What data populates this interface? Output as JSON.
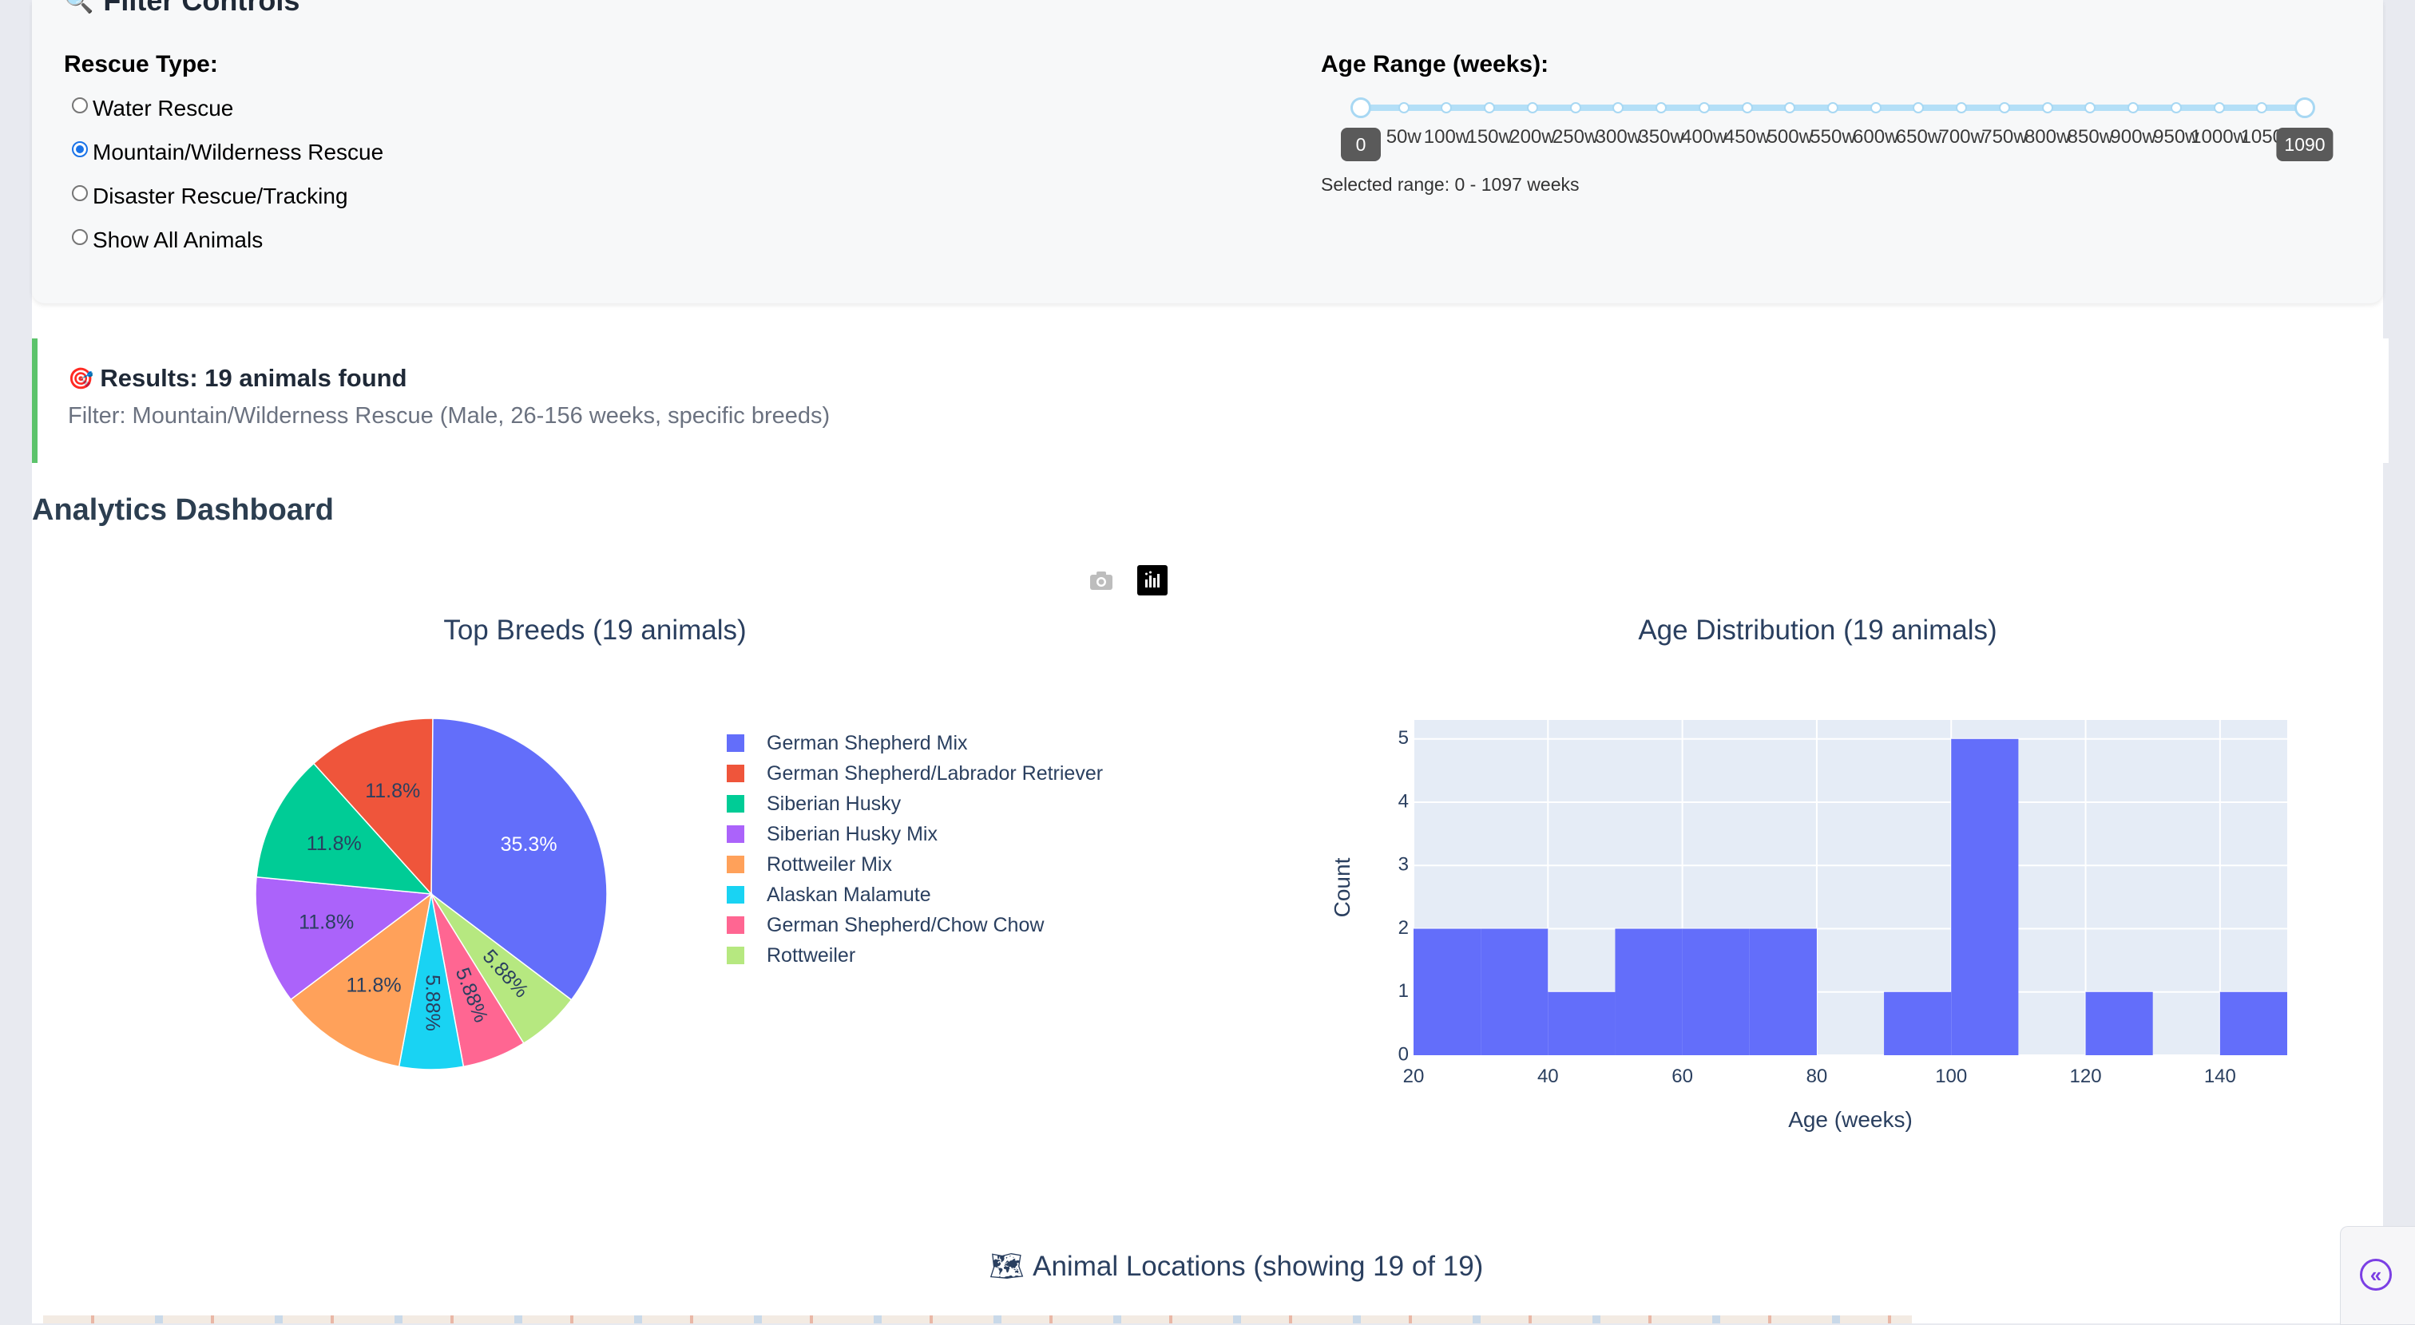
{
  "filter": {
    "title": "Filter Controls",
    "icon": "magnifier-icon",
    "rescue_type_label": "Rescue Type:",
    "rescue_options": [
      {
        "label": "Water Rescue",
        "checked": false
      },
      {
        "label": "Mountain/Wilderness Rescue",
        "checked": true
      },
      {
        "label": "Disaster Rescue/Tracking",
        "checked": false
      },
      {
        "label": "Show All Animals",
        "checked": false
      }
    ],
    "age_label": "Age Range (weeks):",
    "slider": {
      "min": 0,
      "max": 1097,
      "value_low": 0,
      "value_high": 1097,
      "low_tooltip": "0",
      "high_tooltip": "1090",
      "marks": [
        "50w",
        "100w",
        "150w",
        "200w",
        "250w",
        "300w",
        "350w",
        "400w",
        "450w",
        "500w",
        "550w",
        "600w",
        "650w",
        "700w",
        "750w",
        "800w",
        "850w",
        "900w",
        "950w",
        "1000w",
        "1050"
      ],
      "range_text": "Selected range: 0 - 1097 weeks"
    }
  },
  "results": {
    "icon": "target-icon",
    "title": "Results: 19 animals found",
    "subtitle": "Filter: Mountain/Wilderness Rescue (Male, 26-156 weeks, specific breeds)"
  },
  "dashboard": {
    "title": "Analytics Dashboard",
    "modebar": [
      "camera-icon",
      "plotly-logo-icon"
    ]
  },
  "chart_data": [
    {
      "type": "pie",
      "title": "Top Breeds (19 animals)",
      "labels": [
        "German Shepherd Mix",
        "German Shepherd/Labrador Retriever",
        "Siberian Husky",
        "Siberian Husky Mix",
        "Rottweiler Mix",
        "Alaskan Malamute",
        "German Shepherd/Chow Chow",
        "Rottweiler"
      ],
      "values": [
        35.3,
        11.8,
        11.8,
        11.8,
        11.8,
        5.88,
        5.88,
        5.88
      ],
      "slice_order": [
        "German Shepherd Mix",
        "Rottweiler",
        "German Shepherd/Chow Chow",
        "Alaskan Malamute",
        "Rottweiler Mix",
        "Siberian Husky Mix",
        "Siberian Husky",
        "German Shepherd/Labrador Retriever"
      ],
      "slice_labels": [
        "35.3%",
        "5.88%",
        "5.88%",
        "5.88%",
        "11.8%",
        "11.8%",
        "11.8%",
        "11.8%"
      ],
      "colors": [
        "#636efa",
        "#ef553b",
        "#00cc96",
        "#ab63fa",
        "#ffa15a",
        "#19d3f3",
        "#ff6692",
        "#b6e880"
      ],
      "legend_position": "right"
    },
    {
      "type": "bar",
      "title": "Age Distribution (19 animals)",
      "xlabel": "Age (weeks)",
      "ylabel": "Count",
      "bin_start": [
        20,
        30,
        40,
        50,
        60,
        70,
        80,
        90,
        100,
        110,
        120,
        130,
        140
      ],
      "bin_width": 10,
      "values": [
        2,
        2,
        1,
        2,
        2,
        2,
        0,
        1,
        5,
        0,
        1,
        0,
        1
      ],
      "xlim": [
        20,
        150
      ],
      "ylim": [
        0,
        5.3
      ],
      "x_ticks": [
        20,
        40,
        60,
        80,
        100,
        120,
        140
      ],
      "y_ticks": [
        0,
        1,
        2,
        3,
        4,
        5
      ],
      "color": "#636efa",
      "plot_bg": "#e5ecf6",
      "grid": true
    }
  ],
  "locations": {
    "icon": "map-icon",
    "title": "Animal Locations (showing 19 of 19)"
  },
  "sidebar_toggle": {
    "icon": "double-chevron-left-icon",
    "glyph": "«"
  }
}
